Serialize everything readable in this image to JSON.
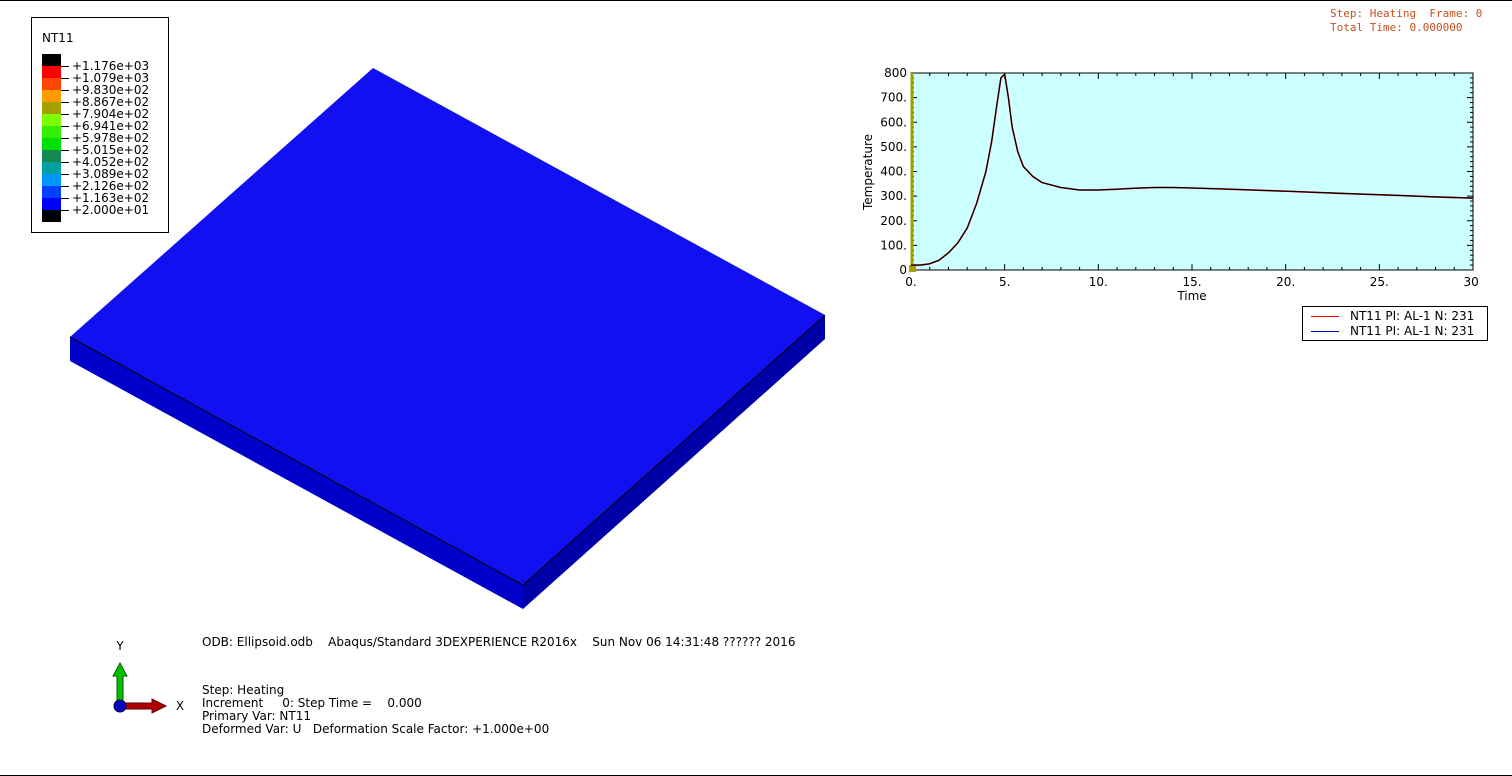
{
  "window": {
    "step_line": "Step: Heating  Frame: 0",
    "time_line": "Total Time: 0.000000"
  },
  "legend": {
    "title": "NT11",
    "entries": [
      {
        "label": "+1.176e+03",
        "color": "#000000"
      },
      {
        "label": "+1.079e+03",
        "color": "#ff0000"
      },
      {
        "label": "+9.830e+02",
        "color": "#ff4500"
      },
      {
        "label": "+8.867e+02",
        "color": "#ff9a00"
      },
      {
        "label": "+7.904e+02",
        "color": "#a4a000"
      },
      {
        "label": "+6.941e+02",
        "color": "#7cff00"
      },
      {
        "label": "+5.978e+02",
        "color": "#33ee00"
      },
      {
        "label": "+5.015e+02",
        "color": "#00e000"
      },
      {
        "label": "+4.052e+02",
        "color": "#158a50"
      },
      {
        "label": "+3.089e+02",
        "color": "#00a0a0"
      },
      {
        "label": "+2.126e+02",
        "color": "#0096ff"
      },
      {
        "label": "+1.163e+02",
        "color": "#0040ff"
      },
      {
        "label": "+2.000e+01",
        "color": "#0000ff"
      }
    ],
    "bottom_color": "#000000"
  },
  "model": {
    "top_color": "#1010f0",
    "side_color": "#0000c8",
    "right_side_color": "#0000a8"
  },
  "chart_data": {
    "type": "line",
    "xlabel": "Time",
    "ylabel": "Temperature",
    "xlim": [
      0,
      30
    ],
    "ylim": [
      0,
      800
    ],
    "xticks": [
      "0.",
      "5.",
      "10.",
      "15.",
      "20.",
      "25.",
      "30."
    ],
    "yticks": [
      "0",
      "100.",
      "200.",
      "300.",
      "400.",
      "500.",
      "600.",
      "700.",
      "800"
    ],
    "background": "#ccffff",
    "series": [
      {
        "name": "NT11 PI: AL-1 N: 231",
        "color": "#ff0000",
        "x": [
          0,
          0.5,
          1,
          1.5,
          2,
          2.5,
          3,
          3.5,
          4,
          4.3,
          4.6,
          4.8,
          5.0,
          5.2,
          5.4,
          5.7,
          6,
          6.5,
          7,
          8,
          9,
          10,
          11,
          12,
          13,
          14,
          15,
          17,
          20,
          23,
          26,
          28,
          30
        ],
        "y": [
          20,
          20,
          25,
          40,
          70,
          110,
          170,
          270,
          400,
          520,
          680,
          780,
          795,
          700,
          580,
          480,
          420,
          380,
          355,
          335,
          325,
          325,
          328,
          332,
          335,
          335,
          333,
          328,
          320,
          311,
          303,
          297,
          292
        ]
      },
      {
        "name": "NT11 PI: AL-1 N: 231",
        "color": "#0000aa",
        "x": [
          0,
          0.5,
          1,
          1.5,
          2,
          2.5,
          3,
          3.5,
          4,
          4.3,
          4.6,
          4.8,
          5.0,
          5.2,
          5.4,
          5.7,
          6,
          6.5,
          7,
          8,
          9,
          10,
          11,
          12,
          13,
          14,
          15,
          17,
          20,
          23,
          26,
          28,
          30
        ],
        "y": [
          20,
          20,
          25,
          40,
          70,
          110,
          170,
          270,
          400,
          520,
          680,
          780,
          795,
          700,
          580,
          480,
          420,
          380,
          355,
          335,
          325,
          325,
          328,
          332,
          335,
          335,
          333,
          328,
          320,
          311,
          303,
          297,
          292
        ]
      }
    ]
  },
  "info": {
    "odb_line": "ODB: Ellipsoid.odb    Abaqus/Standard 3DEXPERIENCE R2016x    Sun Nov 06 14:31:48 ?????? 2016",
    "step": "Step: Heating",
    "increment": "Increment     0: Step Time =    0.000",
    "primary_var": "Primary Var: NT11",
    "deformed_var": "Deformed Var: U   Deformation Scale Factor: +1.000e+00"
  },
  "triad": {
    "x_label": "X",
    "y_label": "Y",
    "x_color": "#b00000",
    "y_color": "#00c000",
    "origin_color": "#0000c0"
  }
}
